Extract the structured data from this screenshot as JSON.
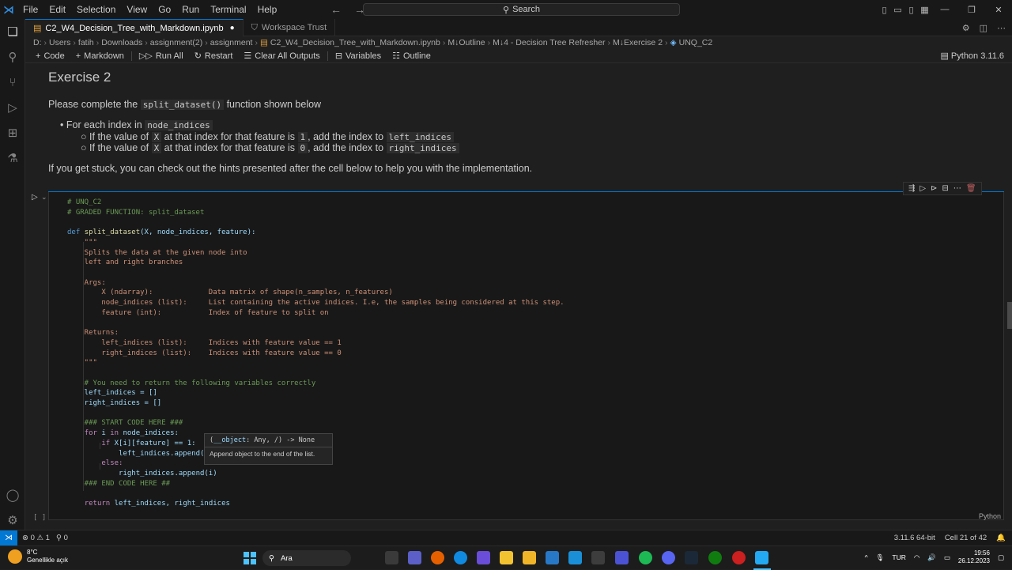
{
  "titlebar": {
    "menu": [
      "File",
      "Edit",
      "Selection",
      "View",
      "Go",
      "Run",
      "Terminal",
      "Help"
    ],
    "search": "Search"
  },
  "tabs": [
    {
      "label": "C2_W4_Decision_Tree_with_Markdown.ipynb",
      "modified": "●"
    },
    {
      "label": "Workspace Trust"
    }
  ],
  "breadcrumb": [
    "D:",
    "Users",
    "fatih",
    "Downloads",
    "assignment(2)",
    "assignment",
    "C2_W4_Decision_Tree_with_Markdown.ipynb",
    "M↓Outline",
    "M↓4 - Decision Tree Refresher",
    "M↓Exercise 2",
    "UNQ_C2"
  ],
  "toolbar": {
    "code": "Code",
    "markdown": "Markdown",
    "run_all": "Run All",
    "restart": "Restart",
    "clear": "Clear All Outputs",
    "variables": "Variables",
    "outline": "Outline",
    "kernel": "Python 3.11.6"
  },
  "markdown": {
    "heading": "Exercise 2",
    "intro_pre": "Please complete the ",
    "intro_code": "split_dataset()",
    "intro_post": " function shown below",
    "b1_pre": "For each index in ",
    "b1_code": "node_indices",
    "b2_pre": "If the value of ",
    "b2_x": "X",
    "b2_mid": " at that index for that feature is ",
    "b2_val": "1",
    "b2_mid2": ", add the index to ",
    "b2_code": "left_indices",
    "b3_pre": "If the value of ",
    "b3_x": "X",
    "b3_mid": " at that index for that feature is ",
    "b3_val": "0",
    "b3_mid2": ", add the index to ",
    "b3_code": "right_indices",
    "hint": "If you get stuck, you can check out the hints presented after the cell below to help you with the implementation."
  },
  "cell": {
    "exec": "[ ]",
    "language": "Python",
    "code": {
      "l1": "# UNQ_C2",
      "l2": "# GRADED FUNCTION: split_dataset",
      "l4_def": "def",
      "l4_fn": "split_dataset",
      "l4_args": "(X, node_indices, feature):",
      "l5": "    \"\"\"",
      "l6": "    Splits the data at the given node into",
      "l7": "    left and right branches",
      "l9": "    Args:",
      "l10": "        X (ndarray):             Data matrix of shape(n_samples, n_features)",
      "l11": "        node_indices (list):     List containing the active indices. I.e, the samples being considered at this step.",
      "l12": "        feature (int):           Index of feature to split on",
      "l14": "    Returns:",
      "l15": "        left_indices (list):     Indices with feature value == 1",
      "l16": "        right_indices (list):    Indices with feature value == 0",
      "l17": "    \"\"\"",
      "l19": "    # You need to return the following variables correctly",
      "l20": "    left_indices = []",
      "l21": "    right_indices = []",
      "l23": "    ### START CODE HERE ###",
      "l24_for": "for",
      "l24_i": "i",
      "l24_in": "in",
      "l24_rest": "node_indices:",
      "l25_if": "if",
      "l25_rest": "X[i][feature] == 1:",
      "l26": "left_indices.append(i)",
      "l27": "else:",
      "l28": "right_indices.append(i)",
      "l29": "    ### END CODE HERE ##",
      "l31_ret": "return",
      "l31_rest": "left_indices, right_indices"
    },
    "tooltip": {
      "sig_pre": "(",
      "sig_param": "__object",
      "sig_post": ": Any, /) -> None",
      "doc": "Append object to the end of the list."
    }
  },
  "statusbar": {
    "problems": "⊗ 0 ⚠ 1",
    "ports": "⚲ 0",
    "python": "3.11.6 64-bit",
    "cell": "Cell 21 of 42"
  },
  "taskbar": {
    "temp": "8°C",
    "weather": "Genellikle açık",
    "search": "Ara",
    "lang": "TUR",
    "time": "19:56",
    "date": "26.12.2023"
  },
  "colors": {
    "accent": "#0078d4",
    "comment": "#6a9955",
    "keyword": "#569cd6"
  }
}
